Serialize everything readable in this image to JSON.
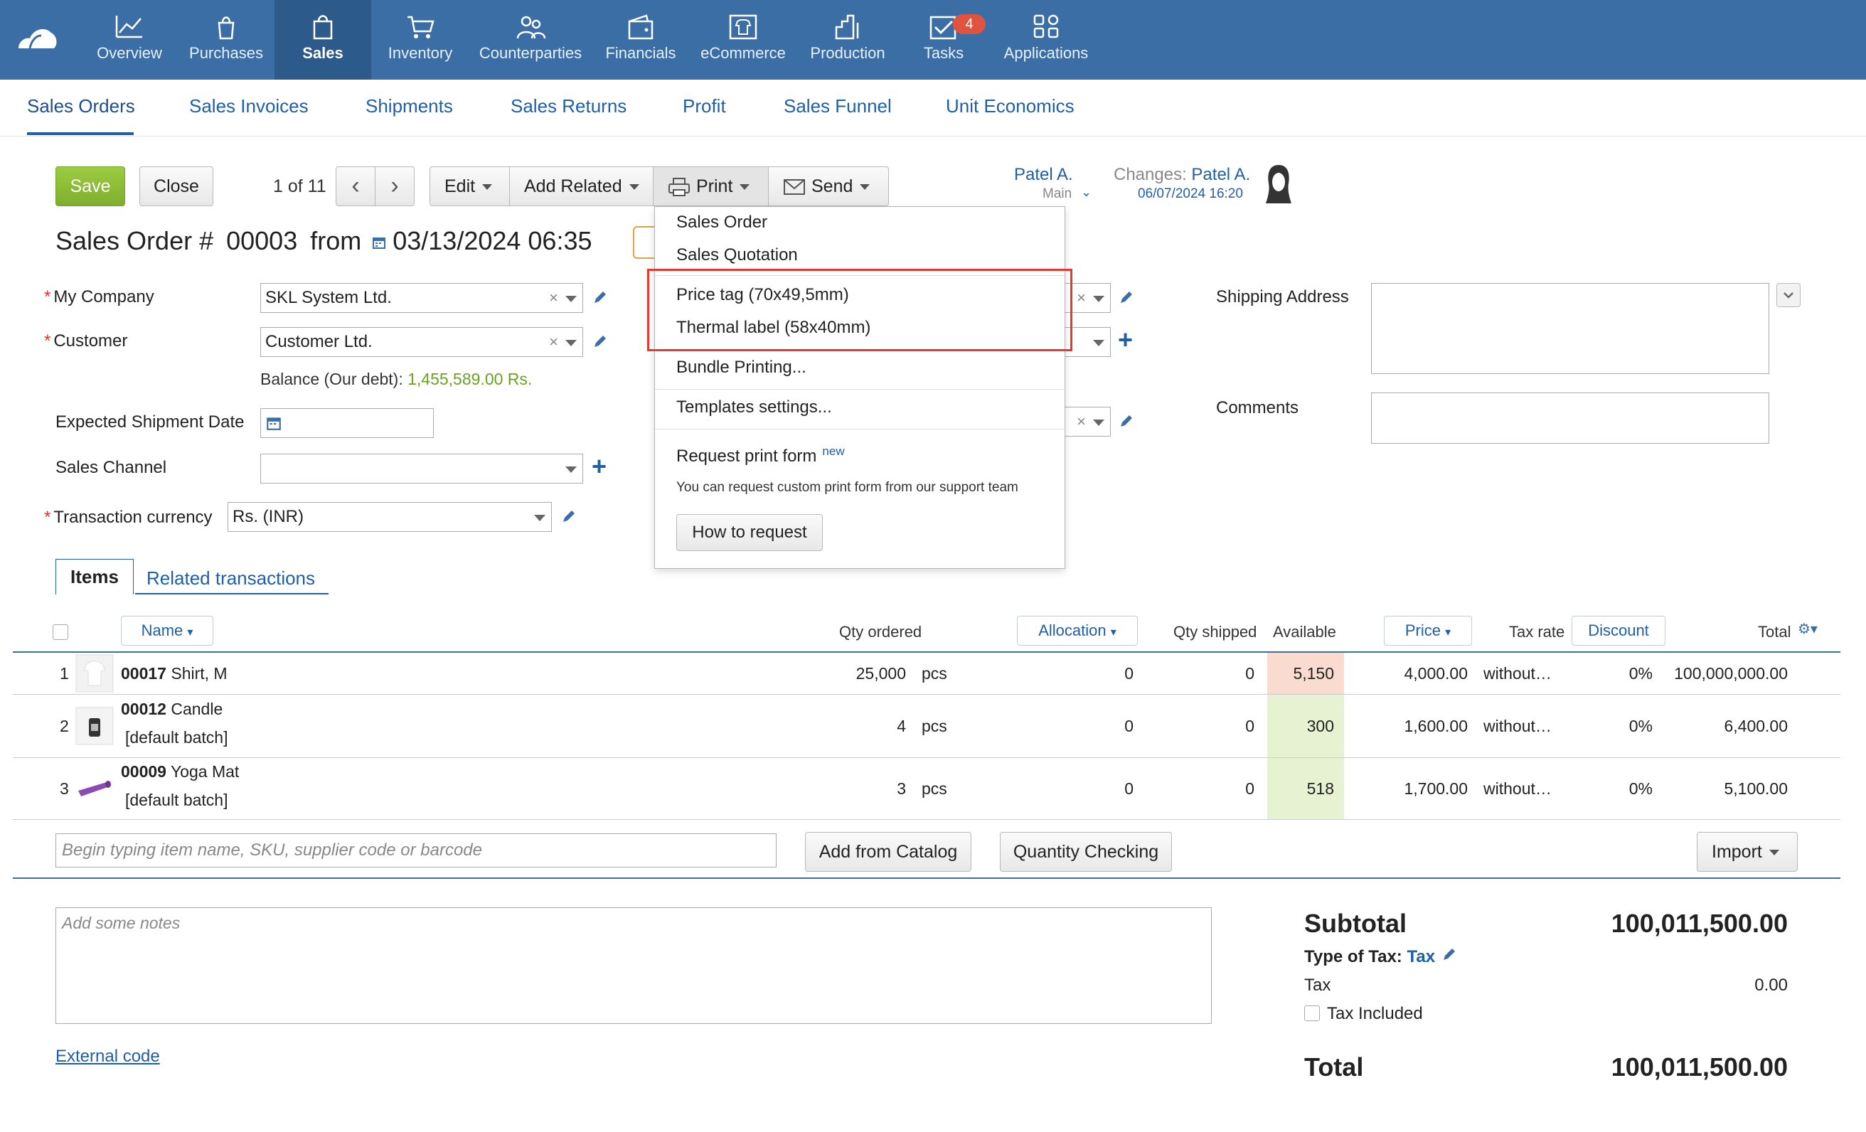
{
  "topnav": {
    "items": [
      {
        "label": "Overview",
        "icon": "chart-line-icon"
      },
      {
        "label": "Purchases",
        "icon": "bag-icon"
      },
      {
        "label": "Sales",
        "icon": "shopping-bag-icon",
        "active": true
      },
      {
        "label": "Inventory",
        "icon": "cart-icon"
      },
      {
        "label": "Counterparties",
        "icon": "people-icon"
      },
      {
        "label": "Financials",
        "icon": "wallet-icon"
      },
      {
        "label": "eCommerce",
        "icon": "shirt-icon"
      },
      {
        "label": "Production",
        "icon": "factory-icon"
      },
      {
        "label": "Tasks",
        "icon": "check-mail-icon"
      },
      {
        "label": "Applications",
        "icon": "apps-grid-icon"
      }
    ],
    "tasks_badge": "4"
  },
  "subnav": {
    "tabs": [
      "Sales Orders",
      "Sales Invoices",
      "Shipments",
      "Sales Returns",
      "Profit",
      "Sales Funnel",
      "Unit Economics"
    ]
  },
  "toolbar": {
    "save": "Save",
    "close": "Close",
    "pager": "1 of 11",
    "edit": "Edit",
    "add_related": "Add Related",
    "print": "Print",
    "send": "Send"
  },
  "owner": {
    "name": "Patel A.",
    "sub": "Main",
    "changes_label": "Changes:",
    "changes_user": "Patel A.",
    "changes_date": "06/07/2024 16:20"
  },
  "title": {
    "prefix": "Sales Order #",
    "number": "00003",
    "from": "from",
    "date": "03/13/2024 06:35"
  },
  "form": {
    "my_company_label": "My Company",
    "my_company_value": "SKL System Ltd.",
    "customer_label": "Customer",
    "customer_value": "Customer Ltd.",
    "balance_label": "Balance (Our debt):",
    "balance_value": "1,455,589.00 Rs.",
    "expected_shipment_label": "Expected Shipment Date",
    "sales_channel_label": "Sales Channel",
    "currency_label": "Transaction currency",
    "currency_value": "Rs. (INR)",
    "shipping_address_label": "Shipping Address",
    "comments_label": "Comments"
  },
  "tabs": {
    "items": "Items",
    "related": "Related transactions"
  },
  "table": {
    "headers": {
      "name": "Name",
      "qty_ordered": "Qty ordered",
      "allocation": "Allocation",
      "qty_shipped": "Qty shipped",
      "available": "Available",
      "price": "Price",
      "tax_rate": "Tax rate",
      "discount": "Discount",
      "total": "Total"
    },
    "rows": [
      {
        "num": "1",
        "code": "00017",
        "name": "Shirt, M",
        "batch": "",
        "qty": "25,000",
        "unit": "pcs",
        "allocation": "0",
        "shipped": "0",
        "available": "5,150",
        "price": "4,000.00",
        "tax": "without…",
        "discount": "0%",
        "total": "100,000,000.00"
      },
      {
        "num": "2",
        "code": "00012",
        "name": "Candle",
        "batch": "[default batch]",
        "qty": "4",
        "unit": "pcs",
        "allocation": "0",
        "shipped": "0",
        "available": "300",
        "price": "1,600.00",
        "tax": "without…",
        "discount": "0%",
        "total": "6,400.00"
      },
      {
        "num": "3",
        "code": "00009",
        "name": "Yoga Mat",
        "batch": "[default batch]",
        "qty": "3",
        "unit": "pcs",
        "allocation": "0",
        "shipped": "0",
        "available": "518",
        "price": "1,700.00",
        "tax": "without…",
        "discount": "0%",
        "total": "5,100.00"
      }
    ],
    "available_colors": [
      "#f9dccf",
      "#e6f2d2",
      "#e6f2d2"
    ],
    "search_placeholder": "Begin typing item name, SKU, supplier code or barcode",
    "add_from_catalog": "Add from Catalog",
    "quantity_checking": "Quantity Checking",
    "import": "Import"
  },
  "bottom": {
    "notes_placeholder": "Add some notes",
    "external_code": "External code",
    "subtotal_label": "Subtotal",
    "subtotal_value": "100,011,500.00",
    "type_of_tax_label": "Type of Tax:",
    "type_of_tax_value": "Tax",
    "tax_label": "Tax",
    "tax_value": "0.00",
    "tax_included_label": "Tax Included",
    "total_label": "Total",
    "total_value": "100,011,500.00"
  },
  "print_menu": {
    "sales_order": "Sales Order",
    "sales_quotation": "Sales Quotation",
    "price_tag": "Price tag (70x49,5mm)",
    "thermal_label": "Thermal label (58x40mm)",
    "bundle_printing": "Bundle Printing...",
    "templates_settings": "Templates settings...",
    "request_form": "Request print form",
    "request_new": "new",
    "request_hint": "You can request custom print form from our support team",
    "how_to_request": "How to request"
  },
  "colors": {
    "brand": "#3a6ea5",
    "save_green": "#8bbd37",
    "link": "#1f5fa6",
    "highlight_box": "#e23a2e"
  }
}
